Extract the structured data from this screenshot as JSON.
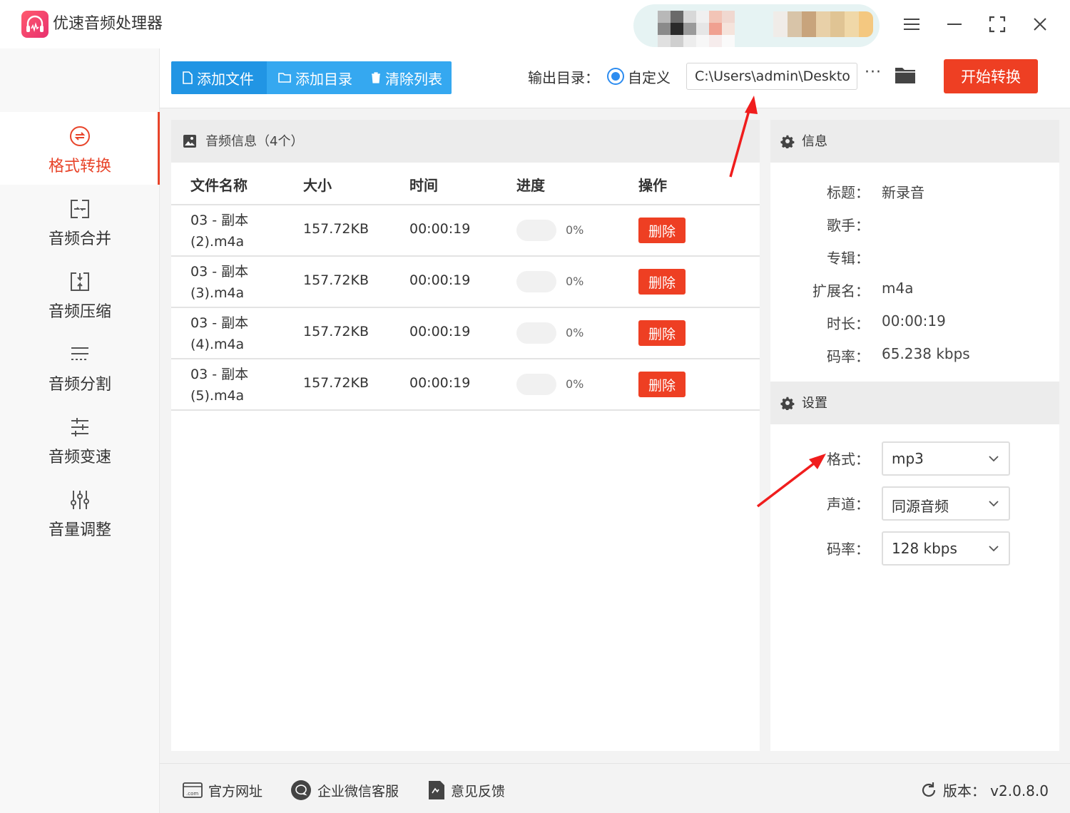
{
  "app": {
    "title": "优速音频处理器"
  },
  "sidebar": {
    "items": [
      {
        "label": "格式转换",
        "icon": "convert-icon",
        "active": true
      },
      {
        "label": "音频合并",
        "icon": "merge-icon",
        "active": false
      },
      {
        "label": "音频压缩",
        "icon": "compress-icon",
        "active": false
      },
      {
        "label": "音频分割",
        "icon": "split-icon",
        "active": false
      },
      {
        "label": "音频变速",
        "icon": "speed-icon",
        "active": false
      },
      {
        "label": "音量调整",
        "icon": "volume-icon",
        "active": false
      }
    ]
  },
  "toolbar": {
    "add_file": "添加文件",
    "add_dir": "添加目录",
    "clear_list": "清除列表",
    "output_label": "输出目录：",
    "custom_label": "自定义",
    "output_path": "C:\\Users\\admin\\Deskto",
    "more": "···",
    "start": "开始转换"
  },
  "file_panel": {
    "title": "音频信息（4个）",
    "columns": [
      "文件名称",
      "大小",
      "时间",
      "进度",
      "操作"
    ],
    "rows": [
      {
        "name_line1": "03 - 副本",
        "name_line2": "(2).m4a",
        "size": "157.72KB",
        "time": "00:00:19",
        "progress": 0,
        "progress_text": "0%",
        "action": "删除"
      },
      {
        "name_line1": "03 - 副本",
        "name_line2": "(3).m4a",
        "size": "157.72KB",
        "time": "00:00:19",
        "progress": 0,
        "progress_text": "0%",
        "action": "删除"
      },
      {
        "name_line1": "03 - 副本",
        "name_line2": "(4).m4a",
        "size": "157.72KB",
        "time": "00:00:19",
        "progress": 0,
        "progress_text": "0%",
        "action": "删除"
      },
      {
        "name_line1": "03 - 副本",
        "name_line2": "(5).m4a",
        "size": "157.72KB",
        "time": "00:00:19",
        "progress": 0,
        "progress_text": "0%",
        "action": "删除"
      }
    ]
  },
  "info": {
    "title": "信息",
    "fields": [
      {
        "key": "标题：",
        "value": "新录音"
      },
      {
        "key": "歌手：",
        "value": ""
      },
      {
        "key": "专辑：",
        "value": ""
      },
      {
        "key": "扩展名：",
        "value": "m4a"
      },
      {
        "key": "时长：",
        "value": "00:00:19"
      },
      {
        "key": "码率：",
        "value": "65.238 kbps"
      }
    ]
  },
  "settings": {
    "title": "设置",
    "fields": [
      {
        "key": "格式：",
        "value": "mp3"
      },
      {
        "key": "声道：",
        "value": "同源音频"
      },
      {
        "key": "码率：",
        "value": "128 kbps"
      }
    ]
  },
  "footer": {
    "website": "官方网址",
    "wechat": "企业微信客服",
    "feedback": "意见反馈",
    "version": "版本：  v2.0.8.0"
  },
  "colors": {
    "accent_red": "#ee3f23",
    "accent_blue": "#35a8f0",
    "active_nav": "#e8442a"
  }
}
